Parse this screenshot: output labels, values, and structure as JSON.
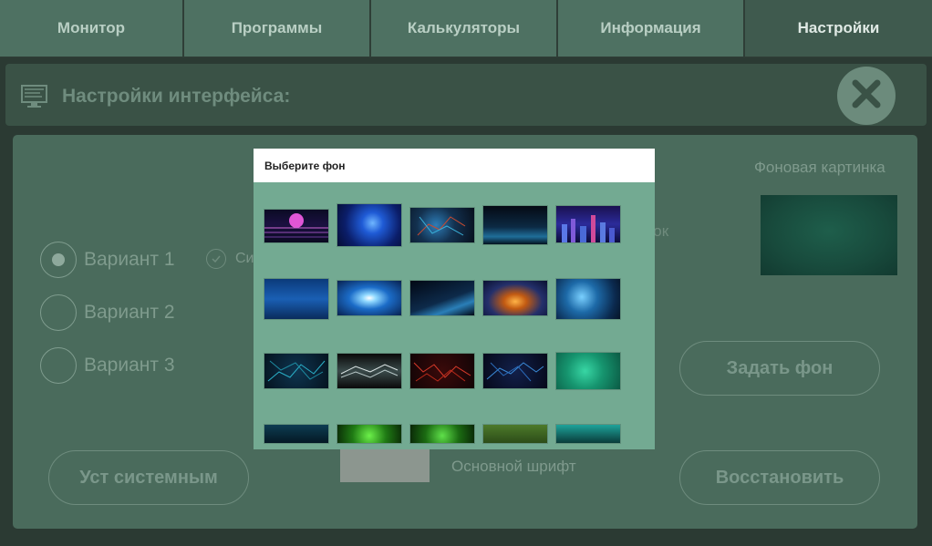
{
  "tabs": [
    {
      "label": "Монитор",
      "active": false
    },
    {
      "label": "Программы",
      "active": false
    },
    {
      "label": "Калькуляторы",
      "active": false
    },
    {
      "label": "Информация",
      "active": false
    },
    {
      "label": "Настройки",
      "active": true
    }
  ],
  "header": {
    "title": "Настройки интерфейса:",
    "icon": "monitor-icon",
    "close_icon": "close-icon"
  },
  "settings": {
    "radio_options": [
      {
        "label": "Вариант 1",
        "selected": true
      },
      {
        "label": "Вариант 2",
        "selected": false
      },
      {
        "label": "Вариант 3",
        "selected": false
      }
    ],
    "checkbox_label_partial": "Си",
    "partial_text": "овок",
    "background_label": "Фоновая картинка",
    "set_background_button": "Задать фон",
    "system_button": "Уст системным",
    "main_font_label": "Основной шрифт",
    "restore_button": "Восстановить"
  },
  "modal": {
    "title": "Выберите фон",
    "thumbnails": [
      "neon-sunset",
      "blue-globe",
      "circuit-network",
      "blue-horizon",
      "neon-city",
      "digital-city",
      "light-burst",
      "blue-wave",
      "orange-tunnel",
      "blue-particles",
      "teal-circuit",
      "dark-lines",
      "red-circuit",
      "blue-circuit",
      "green-gradient",
      "teal-dark",
      "green-foliage",
      "green-sparkle",
      "green-pattern",
      "teal-data"
    ]
  },
  "colors": {
    "page_background": "#2b3a33",
    "tab_background": "#4e7162",
    "active_tab_background": "#3f5a4e",
    "panel_background": "#4a6b5c",
    "modal_background": "#73aa92"
  }
}
